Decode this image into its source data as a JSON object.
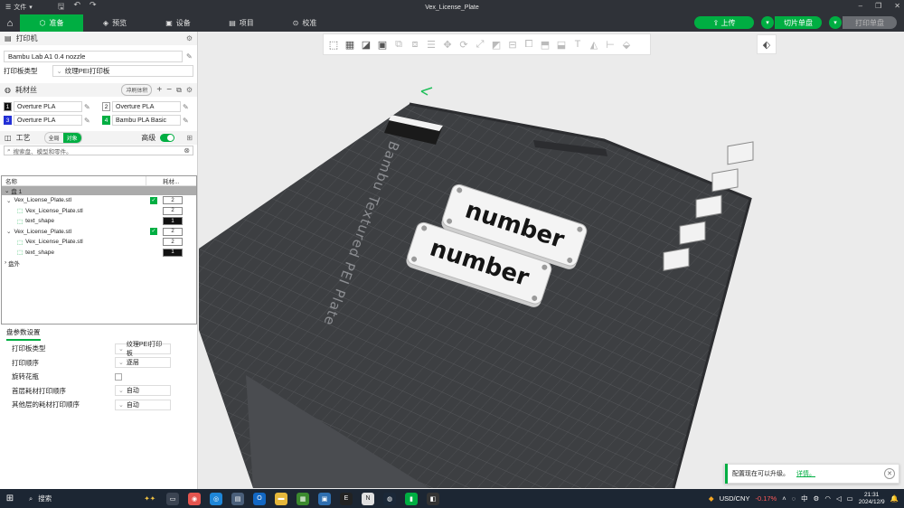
{
  "titlebar": {
    "menu_label": "文件",
    "window_title": "Vex_License_Plate"
  },
  "tabs": [
    {
      "label": "准备",
      "icon": "cube-icon",
      "active": true
    },
    {
      "label": "预览",
      "icon": "layers-icon",
      "active": false
    },
    {
      "label": "设备",
      "icon": "device-icon",
      "active": false
    },
    {
      "label": "项目",
      "icon": "project-icon",
      "active": false
    },
    {
      "label": "校准",
      "icon": "calibrate-icon",
      "active": false
    }
  ],
  "actions": {
    "upload": "上传",
    "slice": "切片单盘",
    "print": "打印单盘"
  },
  "printer": {
    "section_title": "打印机",
    "name": "Bambu Lab A1 0.4 nozzle",
    "plate_type_label": "打印板类型",
    "plate_type_value": "纹理PEI打印板"
  },
  "filament": {
    "section_title": "耗材丝",
    "flush_label": "冲刷体积",
    "slots": [
      {
        "num": "1",
        "name": "Overture PLA",
        "color": "#111111"
      },
      {
        "num": "2",
        "name": "Overture PLA",
        "color": "#ffffff"
      },
      {
        "num": "3",
        "name": "Overture PLA",
        "color": "#2330d6"
      },
      {
        "num": "4",
        "name": "Bambu PLA Basic",
        "color": "#00ae42"
      }
    ]
  },
  "process": {
    "section_title": "工艺",
    "seg_global": "全局",
    "seg_object": "对象",
    "advanced_label": "高级",
    "search_placeholder": "搜索盘、模型和零件。"
  },
  "object_tree": {
    "col_name": "名称",
    "col_filament": "耗材...",
    "plate_label": "盘 1",
    "outside_label": "盘外",
    "items": [
      {
        "name": "Vex_License_Plate.stl",
        "level": 0,
        "filament": "2",
        "checked": true,
        "dark": false
      },
      {
        "name": "Vex_License_Plate.stl",
        "level": 1,
        "filament": "2",
        "checked": false,
        "dark": false
      },
      {
        "name": "text_shape",
        "level": 1,
        "filament": "1",
        "checked": false,
        "dark": true
      },
      {
        "name": "Vex_License_Plate.stl",
        "level": 0,
        "filament": "2",
        "checked": true,
        "dark": false
      },
      {
        "name": "Vex_License_Plate.stl",
        "level": 1,
        "filament": "2",
        "checked": false,
        "dark": false
      },
      {
        "name": "text_shape",
        "level": 1,
        "filament": "1",
        "checked": false,
        "dark": true
      }
    ]
  },
  "plate_settings": {
    "tab_label": "盘参数设置",
    "rows": [
      {
        "label": "打印板类型",
        "value": "纹理PEI打印板",
        "type": "select"
      },
      {
        "label": "打印顺序",
        "value": "逐层",
        "type": "select"
      },
      {
        "label": "旋转花瓶",
        "value": "",
        "type": "checkbox"
      },
      {
        "label": "首层耗材打印顺序",
        "value": "自动",
        "type": "select"
      },
      {
        "label": "其他层的耗材打印顺序",
        "value": "自动",
        "type": "select"
      }
    ]
  },
  "viewport": {
    "bed_text": "Bambu Textured PEI Plate",
    "model_text": "number"
  },
  "notification": {
    "text": "配置现在可以升级。",
    "link": "详情。"
  },
  "taskbar": {
    "search_label": "搜索",
    "currency": "USD/CNY",
    "change": "-0.17%",
    "lang": "中",
    "time": "21:31",
    "date": "2024/12/9"
  },
  "colors": {
    "accent": "#00ae42",
    "dark_chrome": "#2f3238",
    "bed": "#3d3f42"
  }
}
